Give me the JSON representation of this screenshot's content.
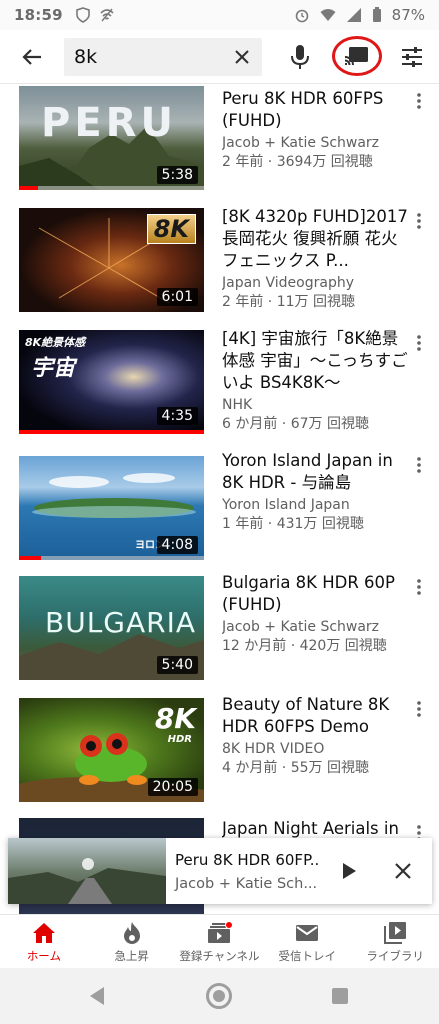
{
  "status_bar": {
    "time": "18:59",
    "battery": "87%"
  },
  "search": {
    "query": "8k"
  },
  "videos": [
    {
      "title": "Peru 8K HDR 60FPS (FUHD)",
      "channel": "Jacob + Katie Schwarz",
      "stats": "2 年前 · 3694万 回視聴",
      "duration": "5:38",
      "thumb_text": "PERU",
      "watched_fraction": 0.1
    },
    {
      "title": "[8K 4320p FUHD]2017 長岡花火 復興祈願 花火フェニックス P...",
      "channel": "Japan Videography",
      "stats": "2 年前 · 11万 回視聴",
      "duration": "6:01",
      "thumb_text": "8K"
    },
    {
      "title": "[4K] 宇宙旅行「8K絶景体感 宇宙」〜こっちすごいよ BS4K8K〜",
      "channel": "NHK",
      "stats": "6 か月前 · 67万 回視聴",
      "duration": "4:35",
      "thumb_text": "8K絶景体感",
      "thumb_text2": "宇宙",
      "watched_fraction": 1.0
    },
    {
      "title": "Yoron Island Japan in 8K HDR - 与論島",
      "channel": "Yoron Island Japan",
      "stats": "1 年前 · 431万 回視聴",
      "duration": "4:08",
      "thumb_text": "ヨロン",
      "watched_fraction": 0.12
    },
    {
      "title": "Bulgaria 8K HDR 60P (FUHD)",
      "channel": "Jacob + Katie Schwarz",
      "stats": "12 か月前 · 420万 回視聴",
      "duration": "5:40",
      "thumb_text": "BULGARIA"
    },
    {
      "title": "Beauty of Nature 8K HDR 60FPS Demo",
      "channel": "8K HDR VIDEO",
      "stats": "4 か月前 · 55万 回視聴",
      "duration": "20:05",
      "thumb_text": "8K",
      "thumb_text2": "HDR"
    },
    {
      "title": "Japan Night Aerials in",
      "channel": "",
      "stats": "",
      "duration": ""
    }
  ],
  "mini_player": {
    "title": "Peru 8K HDR 60FP..",
    "channel": "Jacob + Katie Sch..."
  },
  "bottom_nav": [
    {
      "label": "ホーム",
      "icon": "home-icon",
      "active": true
    },
    {
      "label": "急上昇",
      "icon": "trending-icon"
    },
    {
      "label": "登録チャンネル",
      "icon": "subscriptions-icon",
      "badge": true
    },
    {
      "label": "受信トレイ",
      "icon": "inbox-icon"
    },
    {
      "label": "ライブラリ",
      "icon": "library-icon"
    }
  ],
  "colors": {
    "accent": "#e00000",
    "cast_highlight": "#e01717",
    "secondary_text": "#606060"
  }
}
